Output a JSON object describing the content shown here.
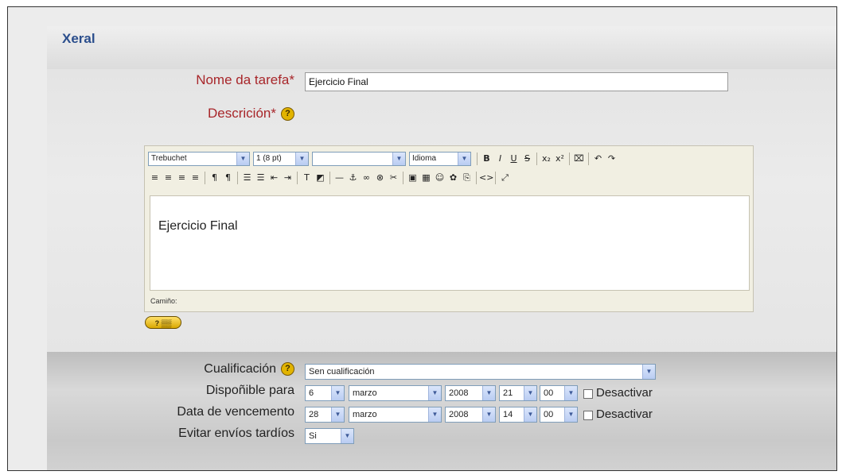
{
  "section": {
    "title": "Xeral"
  },
  "form": {
    "task_name": {
      "label": "Nome da tarefa*",
      "value": "Ejercicio Final"
    },
    "description": {
      "label": "Descrición*",
      "help_icon": "help-icon"
    }
  },
  "editor": {
    "font_family": "Trebuchet",
    "font_size": "1 (8 pt)",
    "format": "",
    "language": "Idioma",
    "toolbar_row1": [
      {
        "name": "bold-icon",
        "glyph": "B"
      },
      {
        "name": "italic-icon",
        "glyph": "I"
      },
      {
        "name": "underline-icon",
        "glyph": "U"
      },
      {
        "name": "strikethrough-icon",
        "glyph": "S"
      },
      {
        "name": "subscript-icon",
        "glyph": "x₂"
      },
      {
        "name": "superscript-icon",
        "glyph": "x²"
      },
      {
        "name": "clean-format-icon",
        "glyph": "⌧"
      },
      {
        "name": "undo-icon",
        "glyph": "↶"
      },
      {
        "name": "redo-icon",
        "glyph": "↷"
      }
    ],
    "toolbar_row2": [
      {
        "name": "align-left-icon",
        "glyph": "≡"
      },
      {
        "name": "align-center-icon",
        "glyph": "≡"
      },
      {
        "name": "align-right-icon",
        "glyph": "≡"
      },
      {
        "name": "justify-icon",
        "glyph": "≡"
      },
      {
        "name": "ltr-icon",
        "glyph": "¶"
      },
      {
        "name": "rtl-icon",
        "glyph": "¶"
      },
      {
        "name": "numbered-list-icon",
        "glyph": "☰"
      },
      {
        "name": "bullet-list-icon",
        "glyph": "☰"
      },
      {
        "name": "outdent-icon",
        "glyph": "⇤"
      },
      {
        "name": "indent-icon",
        "glyph": "⇥"
      },
      {
        "name": "text-color-icon",
        "glyph": "T"
      },
      {
        "name": "background-color-icon",
        "glyph": "◩"
      },
      {
        "name": "horizontal-rule-icon",
        "glyph": "—"
      },
      {
        "name": "anchor-icon",
        "glyph": "⚓"
      },
      {
        "name": "link-icon",
        "glyph": "∞"
      },
      {
        "name": "unlink-icon",
        "glyph": "⊗"
      },
      {
        "name": "no-link-icon",
        "glyph": "✂"
      },
      {
        "name": "image-icon",
        "glyph": "▣"
      },
      {
        "name": "table-icon",
        "glyph": "▦"
      },
      {
        "name": "smiley-icon",
        "glyph": "☺"
      },
      {
        "name": "special-char-icon",
        "glyph": "✿"
      },
      {
        "name": "search-replace-icon",
        "glyph": "⎘"
      },
      {
        "name": "html-source-icon",
        "glyph": "<>"
      },
      {
        "name": "fullscreen-icon",
        "glyph": "⤢"
      }
    ],
    "content": "Ejercicio Final",
    "path_label": "Camiño:"
  },
  "grade": {
    "label": "Cualificación",
    "value": "Sen cualificación"
  },
  "available_from": {
    "label": "Dispoñible para",
    "day": "6",
    "month": "marzo",
    "year": "2008",
    "hour": "21",
    "minute": "00",
    "disable_label": "Desactivar"
  },
  "due_date": {
    "label": "Data de vencemento",
    "day": "28",
    "month": "marzo",
    "year": "2008",
    "hour": "14",
    "minute": "00",
    "disable_label": "Desactivar"
  },
  "prevent_late": {
    "label": "Evitar envíos tardíos",
    "value": "Si"
  }
}
